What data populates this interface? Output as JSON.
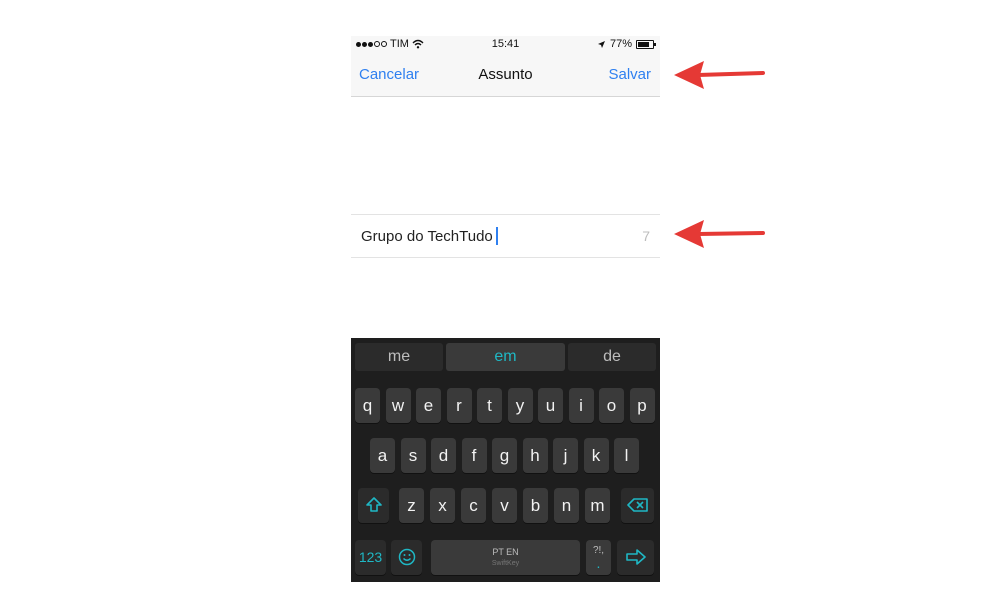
{
  "status": {
    "carrier": "TIM",
    "time": "15:41",
    "battery": "77%",
    "battery_fraction": 0.77
  },
  "nav": {
    "cancel": "Cancelar",
    "title": "Assunto",
    "save": "Salvar"
  },
  "input": {
    "value": "Grupo do TechTudo",
    "count": "7"
  },
  "keyboard": {
    "predictions": {
      "left": "me",
      "center": "em",
      "right": "de"
    },
    "row1": [
      "q",
      "w",
      "e",
      "r",
      "t",
      "y",
      "u",
      "i",
      "o",
      "p"
    ],
    "row2": [
      "a",
      "s",
      "d",
      "f",
      "g",
      "h",
      "j",
      "k",
      "l"
    ],
    "row3": [
      "z",
      "x",
      "c",
      "v",
      "b",
      "n",
      "m"
    ],
    "numbers": "123",
    "space_label": "PT EN",
    "swiftkey_label": "SwiftKey",
    "punct_top": "?!,",
    "punct_bottom": "."
  },
  "colors": {
    "accent_blue": "#2f80f0",
    "swiftkey_teal": "#1fb7c4",
    "arrow_red": "#e53935"
  }
}
